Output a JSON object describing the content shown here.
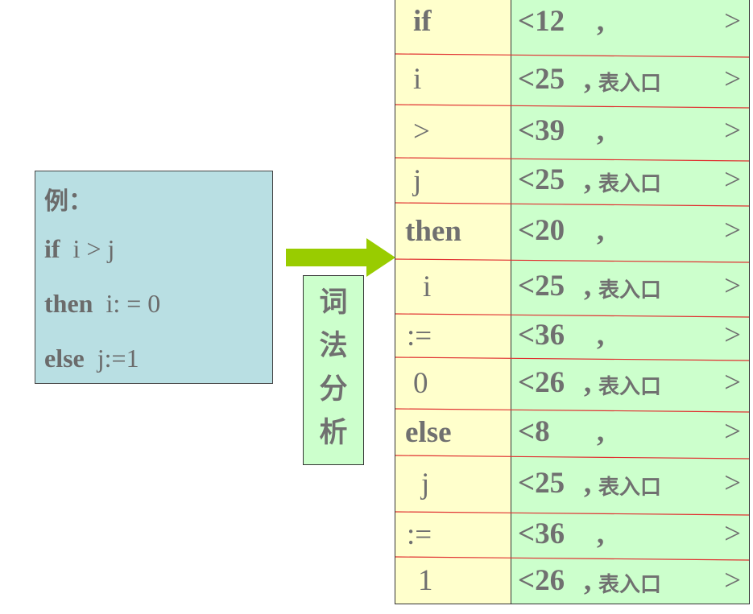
{
  "example": {
    "title": "例：",
    "lines": [
      {
        "kw": "if",
        "rest": "  i > j"
      },
      {
        "kw": "then",
        "rest": "  i: = 0"
      },
      {
        "kw": "else",
        "rest": "  j:=1"
      }
    ]
  },
  "arrow_label": "词\n法\n分\n析",
  "colors": {
    "example_bg": "#b9dfe3",
    "label_bg": "#ccffcc",
    "token_col_bg": "#ffffcc",
    "code_col_bg": "#ccffcc",
    "arrow": "#99cc00",
    "separator": "#e03030",
    "text": "#707070"
  },
  "tokens": [
    {
      "token": "if",
      "bold": true,
      "code": "<12",
      "entry": ""
    },
    {
      "token": "i",
      "bold": false,
      "code": "<25",
      "entry": "表入口"
    },
    {
      "token": ">",
      "bold": false,
      "code": "<39",
      "entry": ""
    },
    {
      "token": "j",
      "bold": false,
      "code": "<25",
      "entry": "表入口"
    },
    {
      "token": "then",
      "bold": true,
      "code": "<20",
      "entry": ""
    },
    {
      "token": "i",
      "bold": false,
      "code": "<25",
      "entry": "表入口"
    },
    {
      "token": ":=",
      "bold": false,
      "code": "<36",
      "entry": ""
    },
    {
      "token": "0",
      "bold": false,
      "code": "<26",
      "entry": "表入口"
    },
    {
      "token": "else",
      "bold": true,
      "code": "<8",
      "entry": ""
    },
    {
      "token": "j",
      "bold": false,
      "code": "<25",
      "entry": "表入口"
    },
    {
      "token": ":=",
      "bold": false,
      "code": "<36",
      "entry": ""
    },
    {
      "token": "1",
      "bold": false,
      "code": "<26",
      "entry": "表入口"
    }
  ],
  "comma": ",",
  "close": ">"
}
